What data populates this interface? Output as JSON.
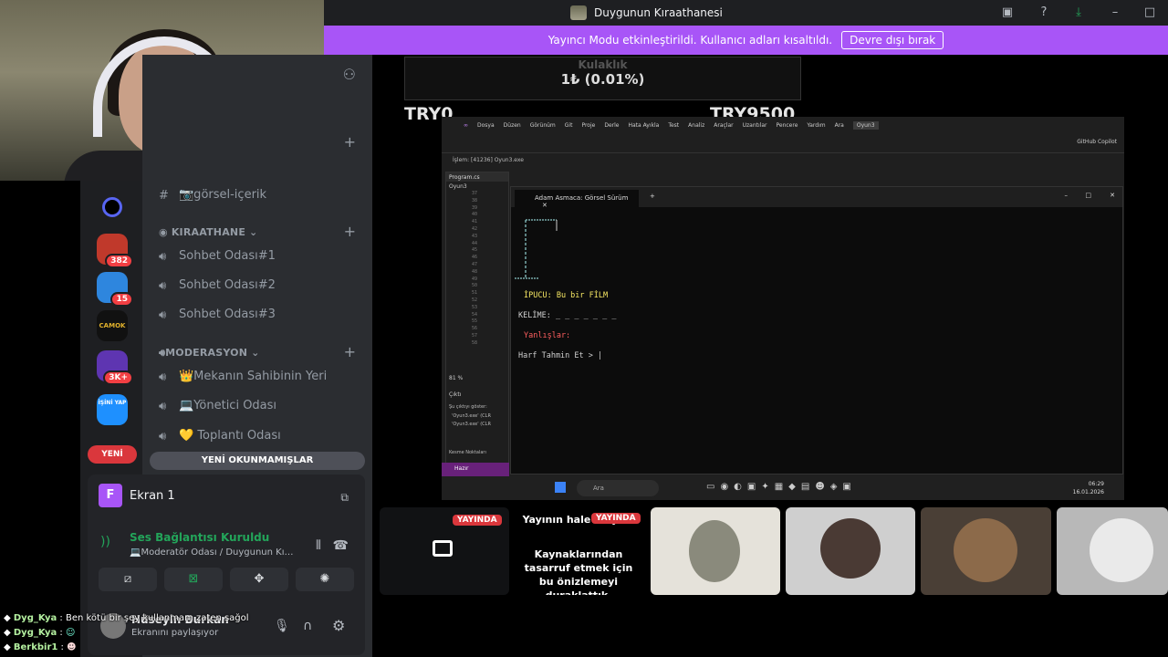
{
  "window": {
    "title": "Duygunun Kıraathanesi"
  },
  "banner": {
    "text": "Yayıncı Modu etkinleştirildi. Kullanıcı adları kısaltıldı.",
    "button": "Devre dışı bırak"
  },
  "servers": [
    {
      "badge": "382"
    },
    {
      "badge": "15"
    },
    {
      "label": "CAMOK"
    },
    {
      "badge": "3K+"
    },
    {
      "label": "İŞİNİ YAP"
    },
    {
      "label": "YENİ"
    }
  ],
  "channels": {
    "text_channel": "📷görsel-içerik",
    "cat1": "KIRAATHANE",
    "voice1": [
      "Sohbet Odası#1",
      "Sohbet Odası#2",
      "Sohbet Odası#3"
    ],
    "cat2": "MODERASYON",
    "voice2": [
      "👑Mekanın Sahibinin Yeri",
      "💻Yönetici Odası",
      "💛 Toplantı Odası"
    ],
    "new_unread": "YENİ OKUNMAMIŞLAR"
  },
  "panel": {
    "screen_label": "Ekran 1",
    "screen_icon": "F",
    "conn_title": "Ses Bağlantısı Kuruldu",
    "conn_sub": "💻Moderatör Odası / Duygunun Kıraa...",
    "username": "Hüseyin Burkan",
    "status": "Ekranını paylaşıyor"
  },
  "chat": [
    {
      "name": "Dyg_Kya",
      "text": ": Ben kötü bir şey kullanmam zaten sağol"
    },
    {
      "name": "Dyg_Kya",
      "text": ":"
    },
    {
      "name": "Berkbir1",
      "text": ":"
    }
  ],
  "stream": {
    "overlay_stat": "1₺ (0.01%)",
    "overlay_header": "Kulaklık",
    "try_left": "TRY0",
    "try_right": "TRY9500",
    "vs": {
      "menu": [
        "Dosya",
        "Düzen",
        "Görünüm",
        "Git",
        "Proje",
        "Derle",
        "Hata Ayıkla",
        "Test",
        "Analiz",
        "Araçlar",
        "Uzantılar",
        "Pencere",
        "Yardım",
        "Ara",
        "Oyun3"
      ],
      "copilot": "GitHub Copilot",
      "process": "İşlem:  [41236] Oyun3.exe",
      "file_tab": "Program.cs",
      "project": "Oyun3",
      "line_numbers": [
        "37",
        "38",
        "39",
        "40",
        "41",
        "42",
        "43",
        "44",
        "45",
        "46",
        "47",
        "48",
        "49",
        "50",
        "51",
        "52",
        "53",
        "54",
        "55",
        "56",
        "57",
        "58"
      ],
      "zoom": "81 %",
      "output": "Çıktı",
      "output_from": "Şu çıktıyı göster:",
      "output_lines": [
        "'Oyun3.exe' (CLR",
        "'Oyun3.exe' (CLR"
      ],
      "breakpoints": "Kesme Noktaları",
      "status": "Hazır"
    },
    "console": {
      "title": "Adam Asmaca: Görsel Sürüm",
      "hint": "İPUCU: Bu bir FİLM",
      "word_label": "KELİME: _ _ _ _ _ _ _",
      "wrong_label": "Yanlışlar:",
      "prompt": "Harf Tahmin Et > |"
    },
    "taskbar": {
      "search": "Ara",
      "time": "06:29",
      "date": "16.01.2026"
    }
  },
  "tiles": {
    "live": "YAYINDA",
    "paused_title": "Yayının hale ediyor!",
    "paused_body": "Kaynaklarından tasarruf etmek için bu önizlemeyi duraklattık."
  }
}
